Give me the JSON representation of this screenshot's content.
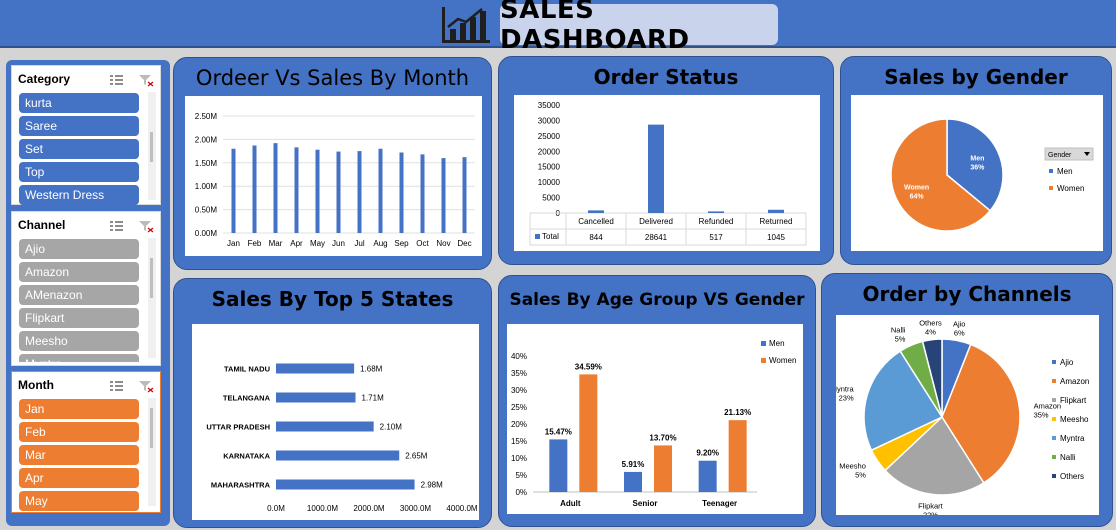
{
  "header": {
    "title": "SALES DASHBOARD"
  },
  "slicers": {
    "category": {
      "title": "Category",
      "items": [
        "kurta",
        "Saree",
        "Set",
        "Top",
        "Western Dress"
      ]
    },
    "channel": {
      "title": "Channel",
      "items": [
        "Ajio",
        "Amazon",
        "AMenazon",
        "Flipkart",
        "Meesho",
        "Myntra"
      ]
    },
    "month": {
      "title": "Month",
      "items": [
        "Jan",
        "Feb",
        "Mar",
        "Apr",
        "May"
      ]
    }
  },
  "colors": {
    "blue": "#4472c4",
    "orange": "#ed7d31",
    "grey": "#a5a5a5",
    "yellow": "#ffc000",
    "lightblue": "#5b9bd5",
    "green": "#70ad47",
    "navy": "#264478"
  },
  "chart_data": [
    {
      "id": "monthly",
      "type": "bar",
      "title": "Ordeer Vs Sales By Month",
      "categories": [
        "Jan",
        "Feb",
        "Mar",
        "Apr",
        "May",
        "Jun",
        "Jul",
        "Aug",
        "Sep",
        "Oct",
        "Nov",
        "Dec"
      ],
      "values": [
        1.8,
        1.87,
        1.92,
        1.83,
        1.78,
        1.74,
        1.75,
        1.8,
        1.72,
        1.68,
        1.6,
        1.62
      ],
      "ytick_labels": [
        "0.00M",
        "0.50M",
        "1.00M",
        "1.50M",
        "2.00M",
        "2.50M"
      ],
      "ylim": [
        0,
        2.5
      ]
    },
    {
      "id": "status",
      "type": "bar",
      "title": "Order Status",
      "categories": [
        "Cancelled",
        "Delivered",
        "Refunded",
        "Returned"
      ],
      "series": [
        {
          "name": "Total",
          "values": [
            844,
            28641,
            517,
            1045
          ]
        }
      ],
      "ytick_labels": [
        "0",
        "5000",
        "10000",
        "15000",
        "20000",
        "25000",
        "30000",
        "35000"
      ],
      "ylim": [
        0,
        35000
      ]
    },
    {
      "id": "gender",
      "type": "pie",
      "title": "Sales by Gender",
      "labels": [
        "Men",
        "Women"
      ],
      "values": [
        36,
        64
      ],
      "slice_labels": [
        "36%",
        "64%"
      ],
      "legend_title": "Gender"
    },
    {
      "id": "states",
      "type": "bar",
      "title": "Sales By Top 5 States",
      "categories": [
        "MAHARASHTRA",
        "KARNATAKA",
        "UTTAR PRADESH",
        "TELANGANA",
        "TAMIL NADU"
      ],
      "values": [
        2.98,
        2.65,
        2.1,
        1.71,
        1.68
      ],
      "value_labels": [
        "2.98M",
        "2.65M",
        "2.10M",
        "1.71M",
        "1.68M"
      ],
      "xtick_labels": [
        "0.0M",
        "1000.0M",
        "2000.0M",
        "3000.0M",
        "4000.0M"
      ]
    },
    {
      "id": "age",
      "type": "bar",
      "title": "Sales By Age Group VS Gender",
      "categories": [
        "Adult",
        "Senior",
        "Teenager"
      ],
      "series": [
        {
          "name": "Men",
          "values": [
            15.47,
            5.91,
            9.2
          ],
          "labels": [
            "15.47%",
            "5.91%",
            "9.20%"
          ]
        },
        {
          "name": "Women",
          "values": [
            34.59,
            13.7,
            21.13
          ],
          "labels": [
            "34.59%",
            "13.70%",
            "21.13%"
          ]
        }
      ],
      "ytick_labels": [
        "0%",
        "5%",
        "10%",
        "15%",
        "20%",
        "25%",
        "30%",
        "35%",
        "40%"
      ],
      "ylim": [
        0,
        40
      ]
    },
    {
      "id": "channels",
      "type": "pie",
      "title": "Order by Channels",
      "labels": [
        "Ajio",
        "Amazon",
        "Flipkart",
        "Meesho",
        "Myntra",
        "Nalli",
        "Others"
      ],
      "values": [
        6,
        35,
        22,
        5,
        23,
        5,
        4
      ],
      "slice_labels": [
        "6%",
        "35%",
        "22%",
        "5%",
        "23%",
        "5%",
        "4%"
      ]
    }
  ]
}
